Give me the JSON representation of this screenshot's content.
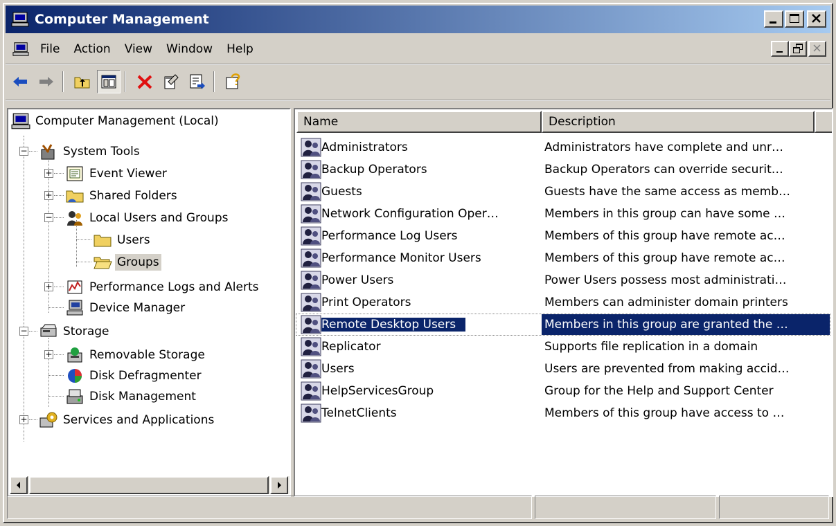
{
  "window": {
    "title": "Computer Management"
  },
  "menu": [
    "File",
    "Action",
    "View",
    "Window",
    "Help"
  ],
  "tree": {
    "root": "Computer Management (Local)",
    "system_tools": "System Tools",
    "event_viewer": "Event Viewer",
    "shared_folders": "Shared Folders",
    "local_users_groups": "Local Users and Groups",
    "users": "Users",
    "groups": "Groups",
    "perf_logs": "Performance Logs and Alerts",
    "device_manager": "Device Manager",
    "storage": "Storage",
    "removable_storage": "Removable Storage",
    "disk_defrag": "Disk Defragmenter",
    "disk_mgmt": "Disk Management",
    "services_apps": "Services and Applications"
  },
  "list": {
    "columns": [
      "Name",
      "Description"
    ],
    "rows": [
      {
        "name": "Administrators",
        "desc": "Administrators have complete and unr…"
      },
      {
        "name": "Backup Operators",
        "desc": "Backup Operators can override securit…"
      },
      {
        "name": "Guests",
        "desc": "Guests have the same access as memb…"
      },
      {
        "name": "Network Configuration Oper…",
        "desc": "Members in this group can have some …"
      },
      {
        "name": "Performance Log Users",
        "desc": "Members of this group have remote ac…"
      },
      {
        "name": "Performance Monitor Users",
        "desc": "Members of this group have remote ac…"
      },
      {
        "name": "Power Users",
        "desc": "Power Users possess most administrati…"
      },
      {
        "name": "Print Operators",
        "desc": "Members can administer domain printers"
      },
      {
        "name": "Remote Desktop Users",
        "desc": "Members in this group are granted the …"
      },
      {
        "name": "Replicator",
        "desc": "Supports file replication in a domain"
      },
      {
        "name": "Users",
        "desc": "Users are prevented from making accid…"
      },
      {
        "name": "HelpServicesGroup",
        "desc": "Group for the Help and Support Center"
      },
      {
        "name": "TelnetClients",
        "desc": "Members of this group have access to …"
      }
    ],
    "selected_index": 8
  },
  "status": {
    "pane1": "",
    "pane2": "",
    "pane3": ""
  },
  "colors": {
    "title_start": "#0a246a",
    "title_end": "#a6caf0",
    "selection": "#0a246a",
    "face": "#d4d0c8"
  }
}
